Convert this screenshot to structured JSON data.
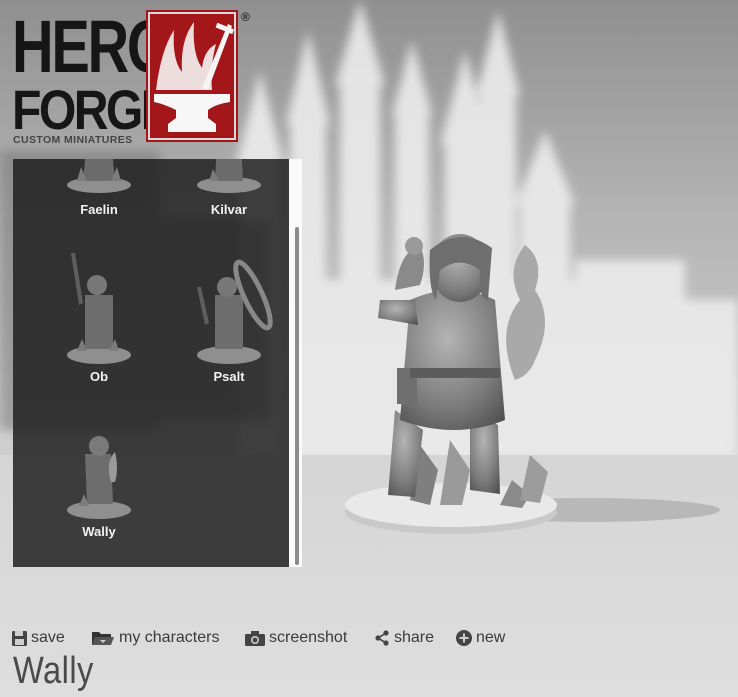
{
  "brand": {
    "line1": "HERO",
    "line2": "FORGE",
    "tagline": "CUSTOM MINIATURES",
    "registered": "®",
    "mark_color": "#a3161a"
  },
  "characters": [
    {
      "name": "Faelin"
    },
    {
      "name": "Kilvar"
    },
    {
      "name": "Ob"
    },
    {
      "name": "Psalt"
    },
    {
      "name": "Wally"
    }
  ],
  "toolbar": {
    "save": {
      "label": "save",
      "icon": "floppy-disk-icon"
    },
    "my_characters": {
      "label": "my characters",
      "icon": "folder-icon"
    },
    "screenshot": {
      "label": "screenshot",
      "icon": "camera-icon"
    },
    "share": {
      "label": "share",
      "icon": "share-icon"
    },
    "new": {
      "label": "new",
      "icon": "plus-circle-icon"
    }
  },
  "character_title": "Wally"
}
